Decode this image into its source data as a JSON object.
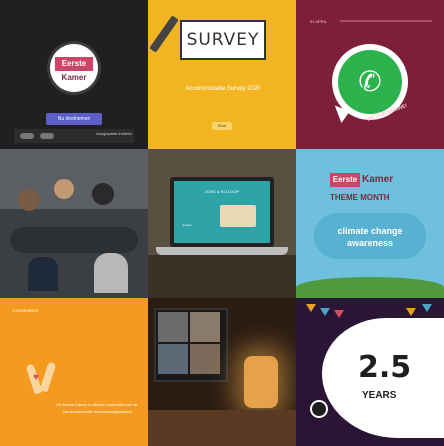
{
  "teams": {
    "logo_top": "Eerste",
    "logo_bottom": "Kamer",
    "join_button": "Nu deelnemen",
    "device_settings": "Aangepaste instellin"
  },
  "survey": {
    "sign_text": "SURVEY",
    "subtitle": "Accommodatie Survey 2020",
    "start_button": "Start"
  },
  "whatsapp": {
    "date_label": "21 APRIL",
    "phone_glyph": "✆",
    "curved_text": "WE ZIJN ONLINE!"
  },
  "laptop": {
    "screen_title": "ZOEK & RIJ LOOP",
    "screen_label": "nieuwe"
  },
  "theme_month": {
    "brand_box": "Eerste",
    "brand_word": "Kamer",
    "theme_label": "THEME MONTH",
    "climate_text": "climate change awareness"
  },
  "celebration": {
    "date_label": "1 NOVEMBER",
    "message": "De Eerste Kamer is officieel onderdeel van de Samenwerkende Huurdersorganisaties"
  },
  "anniversary": {
    "number": "2.5",
    "label": "YEARS"
  },
  "colors": {
    "teams_bg": "#202022",
    "survey_bg": "#f2b521",
    "whatsapp_bg": "#7e1f3a",
    "whatsapp_green": "#2bb24c",
    "theme_bg": "#6fc0dc",
    "celebration_bg": "#f39a1f",
    "anniversary_bg": "#2b1535"
  }
}
